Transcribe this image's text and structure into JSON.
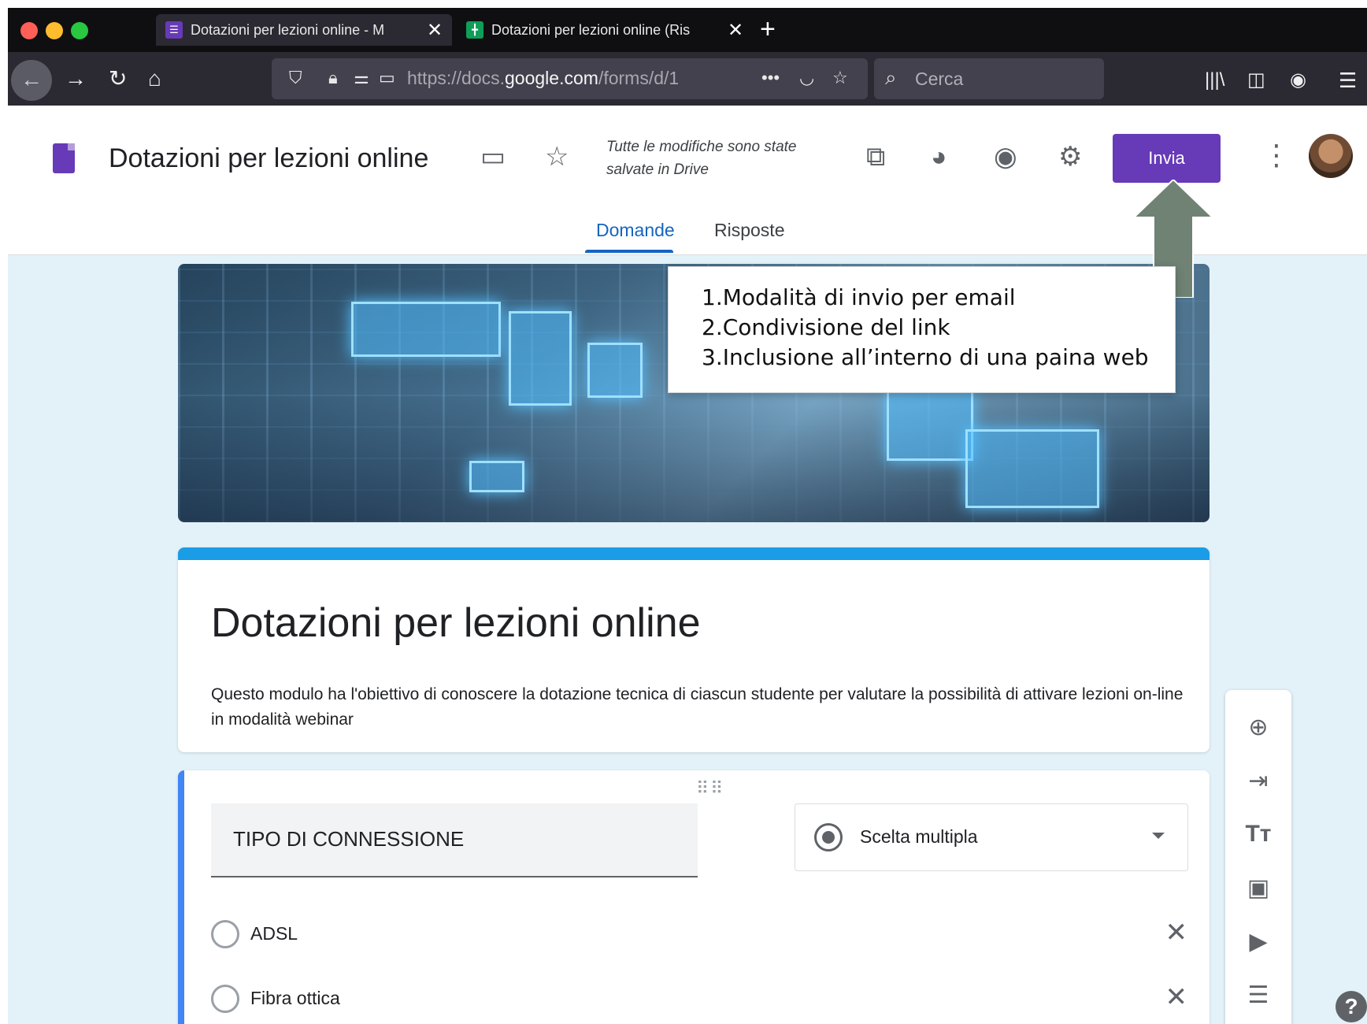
{
  "browser": {
    "tabs": [
      {
        "label": "Dotazioni per lezioni online - M",
        "favicon": "forms-icon",
        "color": "#673ab7"
      },
      {
        "label": "Dotazioni per lezioni online (Ris",
        "favicon": "sheets-icon",
        "color": "#0f9d58"
      }
    ],
    "url_prefix": "https://docs.",
    "url_domain": "google.com",
    "url_suffix": "/forms/d/1",
    "search_placeholder": "Cerca"
  },
  "header": {
    "doc_title": "Dotazioni per lezioni online",
    "save_status": "Tutte le modifiche sono state salvate in Drive",
    "send_label": "Invia",
    "tabs": [
      "Domande",
      "Risposte"
    ],
    "accent": "#673ab7"
  },
  "callout": {
    "lines": [
      "1.Modalità di invio per email",
      "2.Condivisione del link",
      "3.Inclusione all’interno di una paina web"
    ]
  },
  "form": {
    "title": "Dotazioni per lezioni online",
    "description": "Questo modulo ha l'obiettivo di conoscere la dotazione tecnica di ciascun studente per valutare la possibilità di attivare lezioni on-line in modalità webinar",
    "question": {
      "title": "TIPO DI CONNESSIONE",
      "type": "Scelta multipla",
      "options": [
        "ADSL",
        "Fibra ottica"
      ]
    }
  }
}
